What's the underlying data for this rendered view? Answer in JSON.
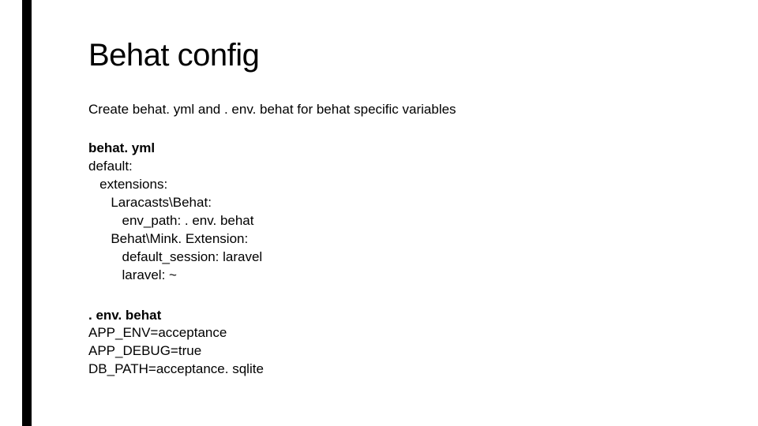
{
  "title": "Behat config",
  "intro": "Create behat. yml and . env. behat for behat specific variables",
  "yml": {
    "heading": "behat. yml",
    "lines": [
      "default:",
      "   extensions:",
      "      Laracasts\\Behat:",
      "         env_path: . env. behat",
      "      Behat\\Mink. Extension:",
      "         default_session: laravel",
      "         laravel: ~"
    ]
  },
  "env": {
    "heading": ". env. behat",
    "lines": [
      "APP_ENV=acceptance",
      "APP_DEBUG=true",
      "DB_PATH=acceptance. sqlite"
    ]
  }
}
